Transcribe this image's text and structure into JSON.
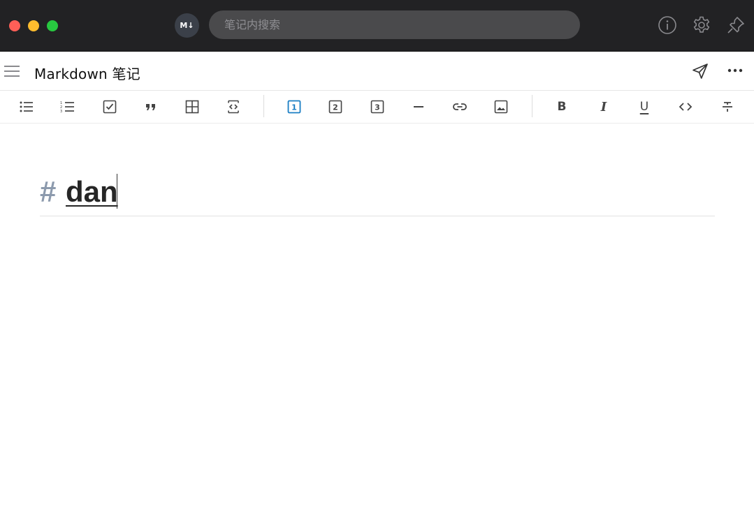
{
  "window": {
    "app_badge": "M↓",
    "search": {
      "placeholder": "笔记内搜索",
      "value": ""
    },
    "icons": [
      "info-icon",
      "gear-icon",
      "pin-icon"
    ]
  },
  "note": {
    "title": "Markdown 笔记",
    "icons": [
      "hamburger-menu-icon",
      "send-icon",
      "more-icon"
    ]
  },
  "toolbar": {
    "groups": [
      [
        "bullet-list",
        "numbered-list",
        "checkbox-list",
        "quote",
        "table",
        "code-block"
      ],
      [
        "heading-1",
        "heading-2",
        "heading-3",
        "horizontal-rule",
        "link",
        "image"
      ],
      [
        "bold",
        "italic",
        "underline",
        "inline-code",
        "strikethrough"
      ]
    ],
    "h1_label": "1",
    "h2_label": "2",
    "h3_label": "3",
    "bold_label": "B",
    "italic_label": "I",
    "underline_label": "U",
    "active": "heading-1",
    "accent_color": "#1a7ec4"
  },
  "editor": {
    "heading_marker": "#",
    "heading_text": "dan"
  },
  "colors": {
    "titlebar": "#222224",
    "search_bg": "#4a4a4c",
    "traffic_red": "#fe5f57",
    "traffic_yellow": "#febc2e",
    "traffic_green": "#28c840",
    "heading_marker": "#8c9aad"
  }
}
